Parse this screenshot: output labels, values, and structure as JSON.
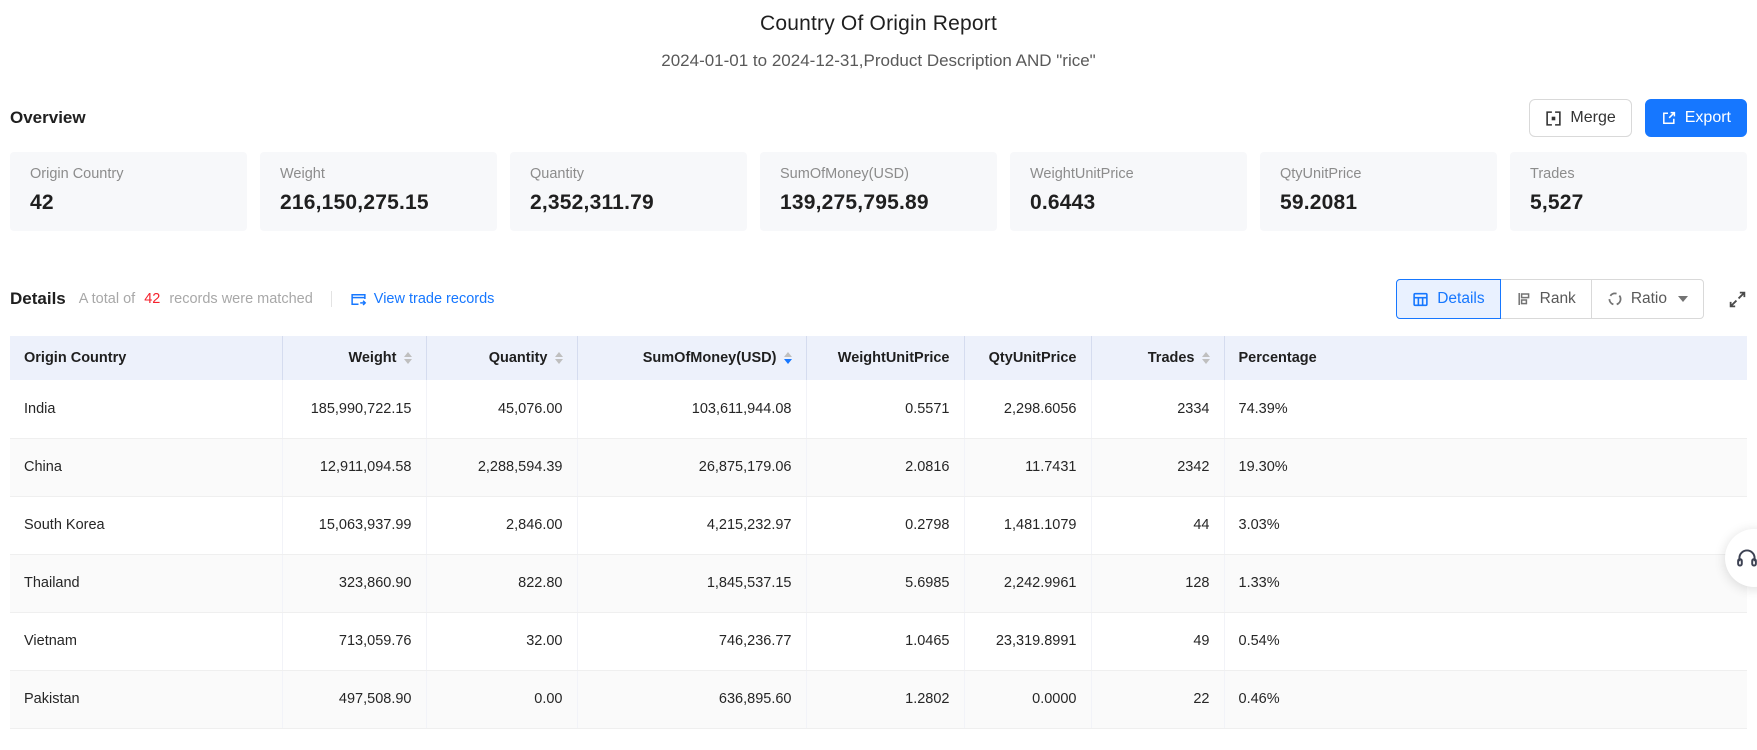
{
  "page": {
    "title": "Country Of Origin Report",
    "subtitle": "2024-01-01 to 2024-12-31,Product Description AND \"rice\""
  },
  "colors": {
    "accent": "#1677ff",
    "danger": "#f5222d",
    "table_header_bg": "#edf1fb",
    "card_bg": "#f7f8fa"
  },
  "overview": {
    "heading": "Overview",
    "merge_label": "Merge",
    "export_label": "Export",
    "cards": [
      {
        "label": "Origin Country",
        "value": "42"
      },
      {
        "label": "Weight",
        "value": "216,150,275.15"
      },
      {
        "label": "Quantity",
        "value": "2,352,311.79"
      },
      {
        "label": "SumOfMoney(USD)",
        "value": "139,275,795.89"
      },
      {
        "label": "WeightUnitPrice",
        "value": "0.6443"
      },
      {
        "label": "QtyUnitPrice",
        "value": "59.2081"
      },
      {
        "label": "Trades",
        "value": "5,527"
      }
    ]
  },
  "details": {
    "heading": "Details",
    "total_prefix": "A total of",
    "total_count": "42",
    "total_suffix": "records were matched",
    "view_link": "View trade records",
    "tabs": [
      {
        "label": "Details",
        "active": true
      },
      {
        "label": "Rank",
        "active": false
      },
      {
        "label": "Ratio",
        "active": false,
        "dropdown": true
      }
    ]
  },
  "table": {
    "columns": [
      {
        "label": "Origin Country",
        "sortable": false,
        "sort": null
      },
      {
        "label": "Weight",
        "sortable": true,
        "sort": null
      },
      {
        "label": "Quantity",
        "sortable": true,
        "sort": null
      },
      {
        "label": "SumOfMoney(USD)",
        "sortable": true,
        "sort": "desc"
      },
      {
        "label": "WeightUnitPrice",
        "sortable": false,
        "sort": null
      },
      {
        "label": "QtyUnitPrice",
        "sortable": false,
        "sort": null
      },
      {
        "label": "Trades",
        "sortable": true,
        "sort": null
      },
      {
        "label": "Percentage",
        "sortable": false,
        "sort": null
      }
    ],
    "rows": [
      [
        "India",
        "185,990,722.15",
        "45,076.00",
        "103,611,944.08",
        "0.5571",
        "2,298.6056",
        "2334",
        "74.39%"
      ],
      [
        "China",
        "12,911,094.58",
        "2,288,594.39",
        "26,875,179.06",
        "2.0816",
        "11.7431",
        "2342",
        "19.30%"
      ],
      [
        "South Korea",
        "15,063,937.99",
        "2,846.00",
        "4,215,232.97",
        "0.2798",
        "1,481.1079",
        "44",
        "3.03%"
      ],
      [
        "Thailand",
        "323,860.90",
        "822.80",
        "1,845,537.15",
        "5.6985",
        "2,242.9961",
        "128",
        "1.33%"
      ],
      [
        "Vietnam",
        "713,059.76",
        "32.00",
        "746,236.77",
        "1.0465",
        "23,319.8991",
        "49",
        "0.54%"
      ],
      [
        "Pakistan",
        "497,508.90",
        "0.00",
        "636,895.60",
        "1.2802",
        "0.0000",
        "22",
        "0.46%"
      ]
    ]
  },
  "floating": {
    "customer_service": "customer-service"
  }
}
